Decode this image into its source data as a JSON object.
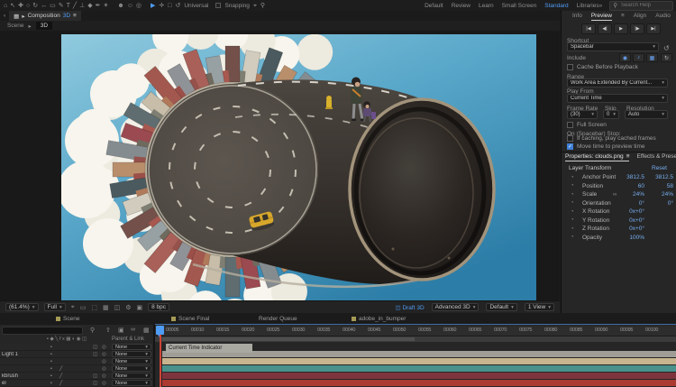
{
  "icons": {
    "caret": "▾",
    "menu": "≡",
    "search": "⚲",
    "reset": "↺",
    "loop": "↻",
    "stopwatch": "◔",
    "link": "∞",
    "fx": "╱",
    "cube": "◫",
    "pickwhip": "◎",
    "switch": "▪",
    "header_switches": "▪◆╲fx▦◐◉◫",
    "chevrons": "»",
    "back": "‹",
    "crumb_sep": "▸",
    "comp_icon": "▦",
    "play_mini": "▸",
    "check": "✓",
    "camera": "▣",
    "filter": "⚲",
    "up_arrow": "⇧",
    "overlap": "▣",
    "infinity": "∞",
    "grid": "▦",
    "target": "⌖",
    "mask": "▭",
    "roi": "⬚",
    "guides": "◫",
    "gear": "⚙",
    "draft_icon": "◫"
  },
  "menubar": {
    "tools": [
      {
        "name": "home-icon",
        "glyph": "⌂"
      },
      {
        "name": "selection-tool-icon",
        "glyph": "↖"
      },
      {
        "name": "hand-tool-icon",
        "glyph": "✚"
      },
      {
        "name": "zoom-tool-icon",
        "glyph": "○"
      },
      {
        "name": "orbit-camera-tool-icon",
        "glyph": "↻"
      },
      {
        "name": "pan-camera-tool-icon",
        "glyph": "↔"
      },
      {
        "name": "shape-tool-icon",
        "glyph": "▭"
      },
      {
        "name": "pen-tool-icon",
        "glyph": "✎"
      },
      {
        "name": "type-tool-icon",
        "glyph": "T"
      },
      {
        "name": "line-tool-icon",
        "glyph": "╱"
      },
      {
        "name": "axis-tool-icon",
        "glyph": "⊥"
      },
      {
        "name": "mask-tool-icon",
        "glyph": "◆"
      },
      {
        "name": "brush-tool-icon",
        "glyph": "✒"
      },
      {
        "name": "puppet-tool-icon",
        "glyph": "✶"
      }
    ],
    "people_tools": [
      {
        "name": "roto-brush-tool-icon",
        "glyph": "☻"
      },
      {
        "name": "puppet-pin-tool-icon",
        "glyph": "☺"
      },
      {
        "name": "tracker-tool-icon",
        "glyph": "◎"
      }
    ],
    "active_tool_glyph": "▶",
    "gizmo_plus": "✛",
    "gizmo_box": "□",
    "gizmo_rotate": "↺",
    "universal_label": "Universal",
    "snapping_label": "Snapping",
    "workspaces": [
      "Default",
      "Review",
      "Learn",
      "Small Screen",
      "Standard",
      "Libraries"
    ],
    "active_workspace": "Standard",
    "search_placeholder": "Search Help"
  },
  "composition": {
    "tab_label": "Composition",
    "comp_name": "3D",
    "breadcrumb": {
      "parent": "Scene",
      "current": "3D"
    },
    "bottom": {
      "zoom": "(61.4%)",
      "resolution": "Full",
      "color_depth": "8 bpc",
      "draft3d": "Draft 3D",
      "renderer": "Advanced 3D",
      "view_layout": "Default",
      "views": "1 View"
    }
  },
  "preview": {
    "tabs": [
      "Info",
      "Preview",
      "Align",
      "Audio"
    ],
    "active_tab": "Preview",
    "transport": [
      {
        "name": "first-frame-button",
        "glyph": "|◀"
      },
      {
        "name": "previous-frame-button",
        "glyph": "◀|"
      },
      {
        "name": "play-button",
        "glyph": "▶"
      },
      {
        "name": "next-frame-button",
        "glyph": "|▶"
      },
      {
        "name": "last-frame-button",
        "glyph": "▶|"
      }
    ],
    "shortcut_label": "Shortcut",
    "shortcut_value": "Spacebar",
    "include_label": "Include",
    "include_icons": [
      {
        "name": "include-video-icon",
        "glyph": "◉"
      },
      {
        "name": "include-audio-icon",
        "glyph": "♪"
      },
      {
        "name": "include-overlays-icon",
        "glyph": "▦"
      }
    ],
    "cache_label": "Cache Before Playback",
    "range_label": "Range",
    "range_value": "Work Area Extended By Current...",
    "play_from_label": "Play From",
    "play_from_value": "Current Time",
    "frame_rate_label": "Frame Rate",
    "frame_rate_value": "(30)",
    "skip_label": "Skip",
    "skip_value": "0",
    "resolution_label": "Resolution",
    "resolution_value": "Auto",
    "full_screen_label": "Full Screen",
    "on_stop_label": "On (Spacebar) Stop:",
    "cache_play_label": "If caching, play cached frames",
    "move_time_label": "Move time to preview time"
  },
  "properties": {
    "tab_label": "Properties: clouds.png",
    "neighbor_tab": "Effects & Prese",
    "section_label": "Layer Transform",
    "reset_label": "Reset",
    "rows": [
      {
        "name": "Anchor Point",
        "v1": "3812.5",
        "v2": "3812.5"
      },
      {
        "name": "Position",
        "v1": "60",
        "v2": "58"
      },
      {
        "name": "Scale",
        "v1": "24%",
        "v2": "24%"
      },
      {
        "name": "Orientation",
        "v1": "0°",
        "v2": "0°"
      },
      {
        "name": "X Rotation",
        "v1": "0x+0°",
        "v2": ""
      },
      {
        "name": "Y Rotation",
        "v1": "0x+0°",
        "v2": ""
      },
      {
        "name": "Z Rotation",
        "v1": "0x+0°",
        "v2": ""
      },
      {
        "name": "Opacity",
        "v1": "100%",
        "v2": ""
      }
    ]
  },
  "timeline": {
    "tabs": [
      {
        "label": "Scene"
      },
      {
        "label": "Scene Final"
      },
      {
        "label": "Render Queue"
      },
      {
        "label": "adobe_in_bumper"
      }
    ],
    "parent_link_label": "Parent & Link",
    "layers": [
      {
        "name": "",
        "parent": "None"
      },
      {
        "name": "Light 1",
        "parent": "None"
      },
      {
        "name": "",
        "parent": "None"
      },
      {
        "name": "",
        "parent": "None"
      },
      {
        "name": "kbrush",
        "parent": "None"
      },
      {
        "name": "el",
        "parent": "None"
      }
    ],
    "ruler_labels": [
      "00005",
      "00010",
      "00015",
      "00020",
      "00025",
      "00030",
      "00035",
      "00040",
      "00045",
      "00050",
      "00055",
      "00060",
      "00065",
      "00070",
      "00075",
      "00080",
      "00085",
      "00090",
      "00095",
      "00100"
    ],
    "cti_tooltip": "Current Time Indicator",
    "bar_colors": [
      "#9f9d95",
      "#c8b48e",
      "#4a918c",
      "#7e343c",
      "#ab3a30"
    ]
  },
  "scene_colors": {
    "sky_top": "#90cade",
    "sky_bottom": "#2c7da7",
    "tube": "#38332e",
    "road": "#544e48",
    "cloud": "#f7f5ed",
    "taxi": "#d7a72b"
  }
}
